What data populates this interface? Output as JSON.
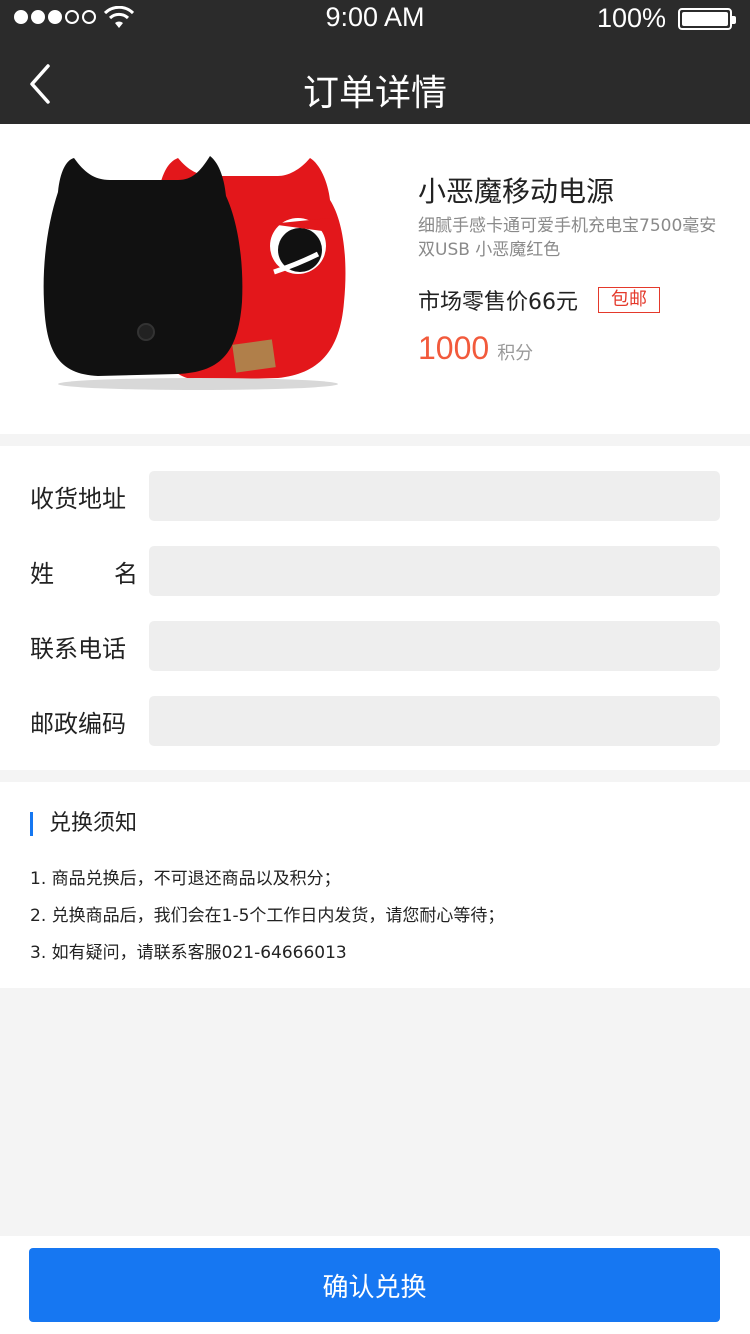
{
  "status_bar": {
    "time": "9:00 AM",
    "battery": "100%",
    "signal_strength": 3,
    "signal_max": 5
  },
  "nav": {
    "title": "订单详情",
    "back_icon": "chevron-left-icon"
  },
  "product": {
    "name": "小恶魔移动电源",
    "description": "细腻手感卡通可爱手机充电宝7500毫安双USB 小恶魔红色",
    "market_price": "市场零售价66元",
    "shipping_badge": "包邮",
    "points_value": "1000",
    "points_unit": "积分"
  },
  "form": {
    "fields": [
      {
        "label": "收货地址",
        "value": "",
        "placeholder": ""
      },
      {
        "label": "姓名",
        "value": "",
        "placeholder": ""
      },
      {
        "label": "联系电话",
        "value": "",
        "placeholder": ""
      },
      {
        "label": "邮政编码",
        "value": "",
        "placeholder": ""
      }
    ]
  },
  "notice": {
    "title": "兑换须知",
    "items": [
      "1. 商品兑换后，不可退还商品以及积分；",
      "2. 兑换商品后，我们会在1-5个工作日内发货，请您耐心等待；",
      "3. 如有疑问，请联系客服021-64666013"
    ]
  },
  "confirm_button": "确认兑换",
  "colors": {
    "accent": "#1677f2",
    "points": "#f25a3c",
    "badge": "#e4392b",
    "header": "#2b2b2b"
  }
}
